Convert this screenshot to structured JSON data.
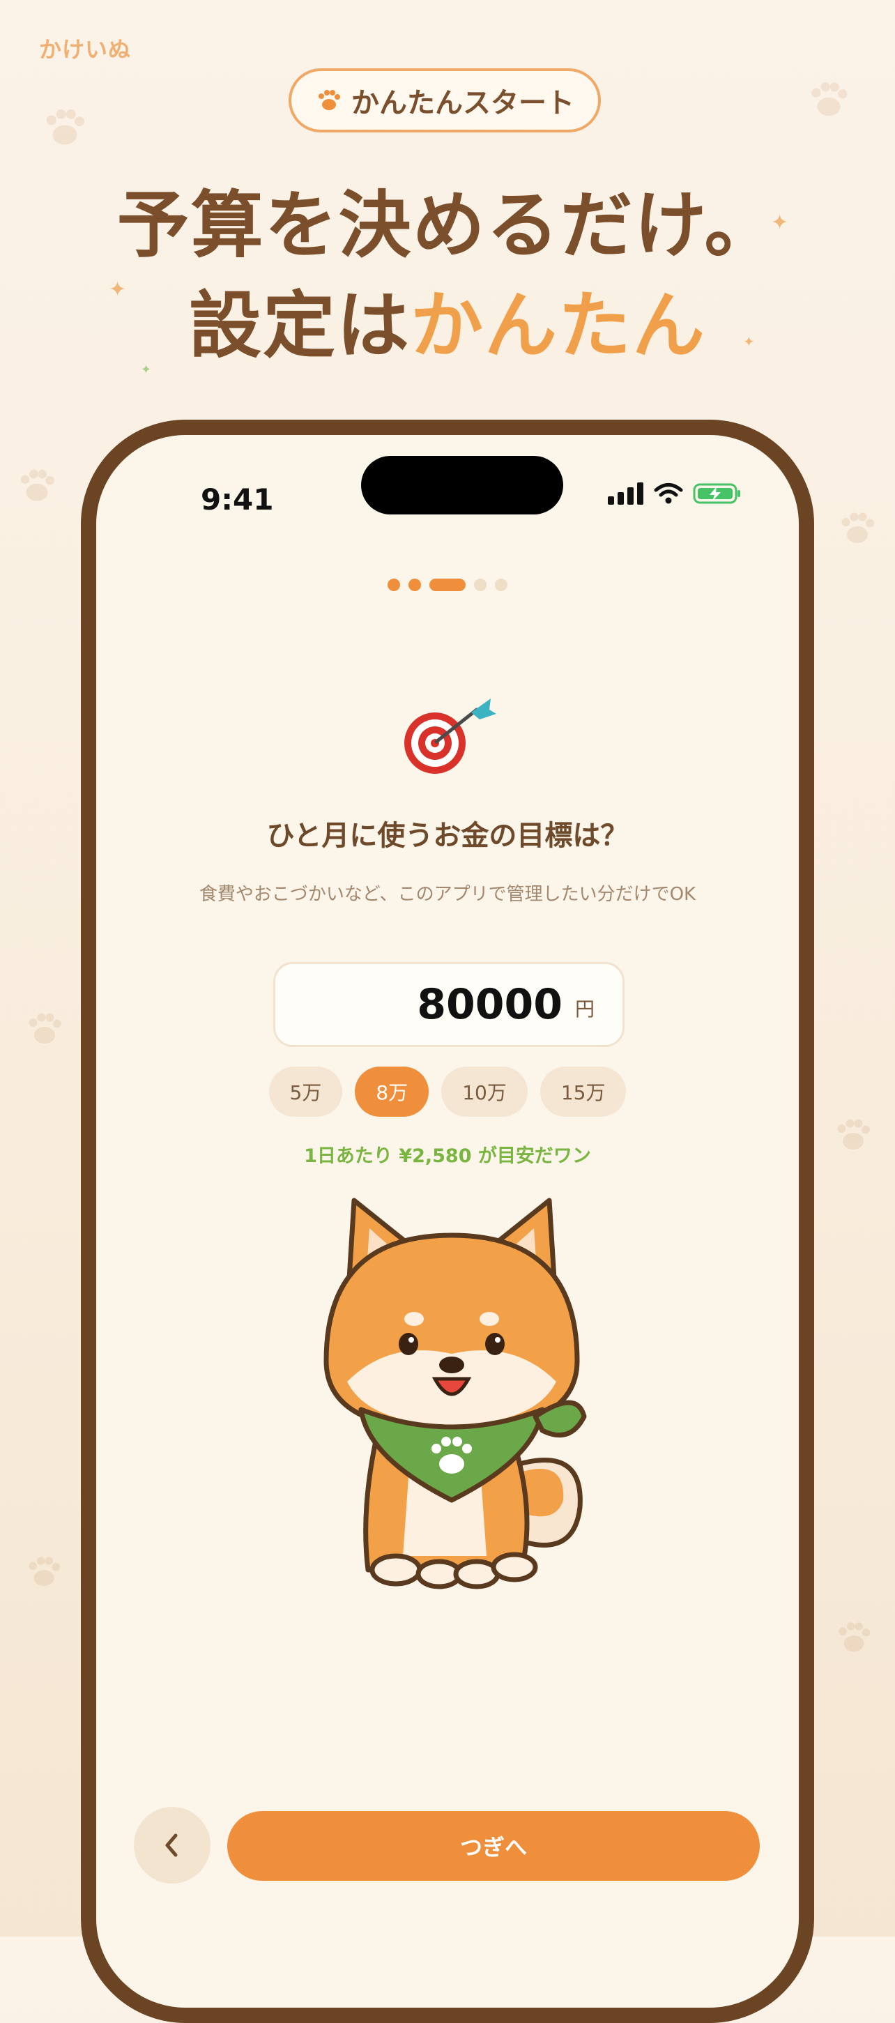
{
  "brand": "かけいぬ",
  "badge": {
    "label": "かんたんスタート",
    "icon": "paw-icon"
  },
  "headline": {
    "line1": "予算を決めるだけ。",
    "line2_prefix": "設定は",
    "line2_accent": "かんたん"
  },
  "status_bar": {
    "time": "9:41"
  },
  "progress": {
    "total_steps": 5,
    "current_step": 3
  },
  "question": "ひと月に使うお金の目標は？",
  "hint": "食費やおこづかいなど、このアプリで管理したい分だけでOK",
  "budget": {
    "value": "80000",
    "unit": "円"
  },
  "presets": [
    {
      "label": "5万",
      "selected": false
    },
    {
      "label": "8万",
      "selected": true
    },
    {
      "label": "10万",
      "selected": false
    },
    {
      "label": "15万",
      "selected": false
    }
  ],
  "per_day": "1日あたり ¥2,580 が目安だワン",
  "buttons": {
    "next": "つぎへ",
    "back_icon": "chevron-left-icon"
  },
  "colors": {
    "accent": "#ef8e3b",
    "brown": "#6a4423",
    "green": "#7ab441"
  }
}
